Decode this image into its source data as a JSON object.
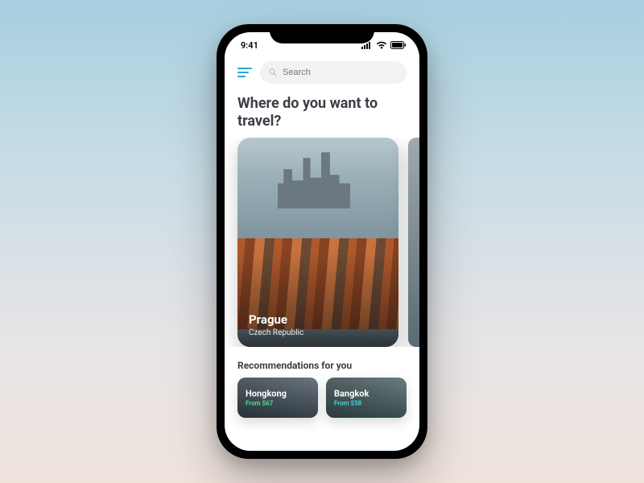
{
  "status": {
    "time": "9:41"
  },
  "search": {
    "placeholder": "Search"
  },
  "heading": "Where do you want to travel?",
  "featured": {
    "card": {
      "city": "Prague",
      "country": "Czech Republic"
    }
  },
  "recommendations": {
    "title": "Recommendations for you",
    "items": [
      {
        "city": "Hongkong",
        "price": "From $67"
      },
      {
        "city": "Bangkok",
        "price": "From $58"
      }
    ]
  }
}
